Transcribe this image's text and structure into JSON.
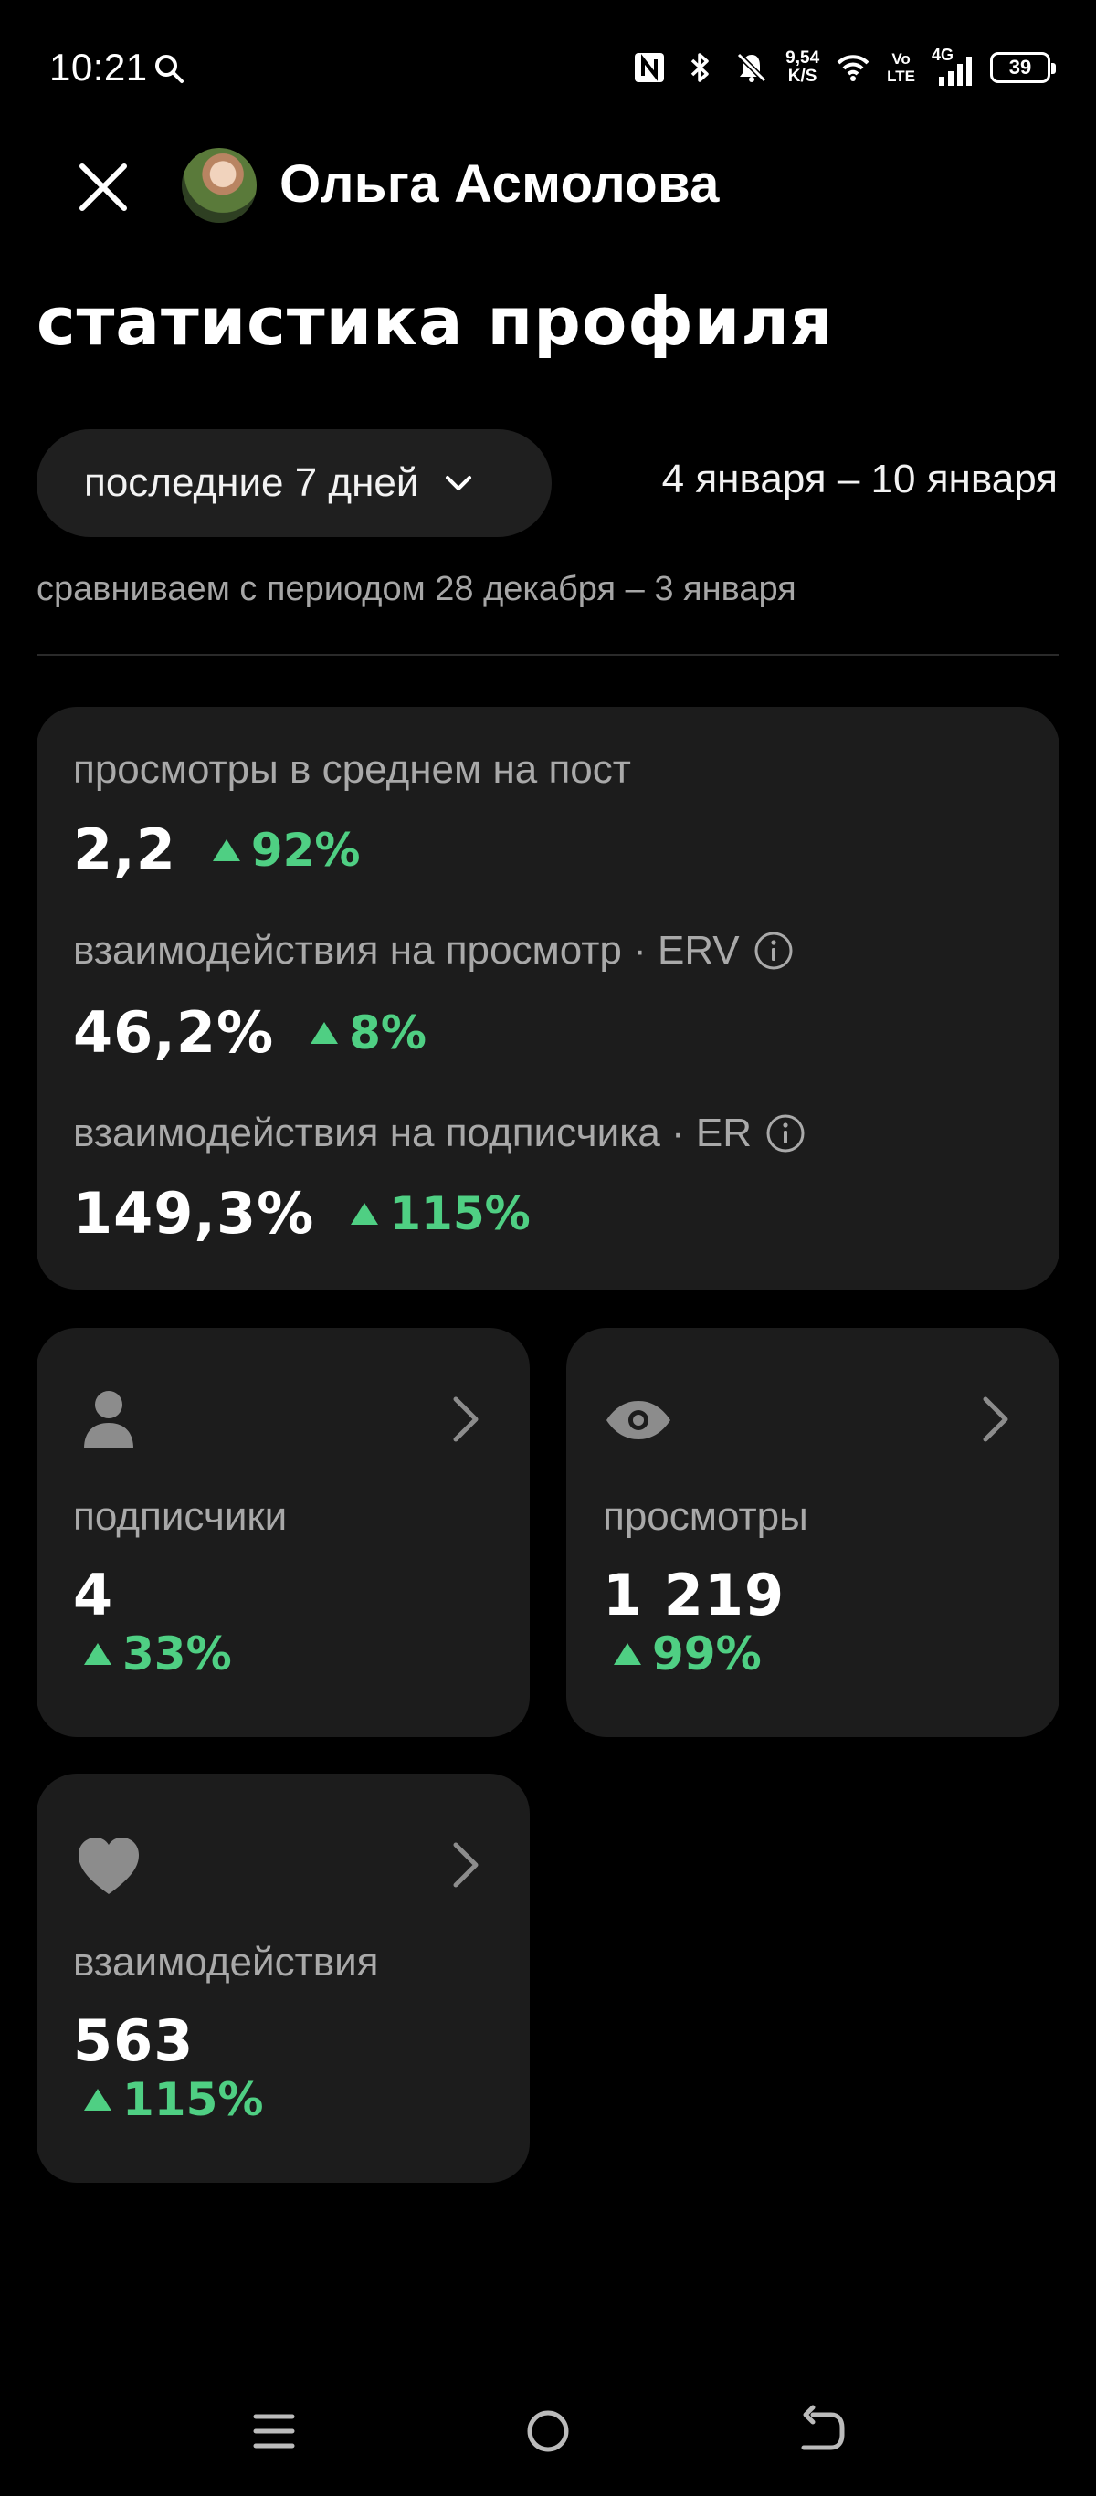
{
  "status_bar": {
    "time": "10:21",
    "net_speed_value": "9,54",
    "net_speed_unit": "K/S",
    "volte_top": "Vo",
    "volte_bottom": "LTE",
    "signal_label": "4G",
    "battery": "39"
  },
  "header": {
    "user_name": "Ольга Асмолова"
  },
  "page_title": "статистика профиля",
  "period": {
    "selected": "последние 7 дней",
    "date_range": "4 января – 10 января",
    "comparison": "сравниваем с периодом 28 декабря – 3 января"
  },
  "summary": {
    "metrics": [
      {
        "label": "просмотры в среднем на пост",
        "value": "2,2",
        "delta": "92%"
      },
      {
        "label": "взаимодействия на просмотр · ERV",
        "value": "46,2%",
        "delta": "8%"
      },
      {
        "label": "взаимодействия на подписчика · ER",
        "value": "149,3%",
        "delta": "115%"
      }
    ]
  },
  "tiles": [
    {
      "icon": "person-icon",
      "label": "подписчики",
      "value": "4",
      "delta": "33%"
    },
    {
      "icon": "eye-icon",
      "label": "просмотры",
      "value": "1 219",
      "delta": "99%"
    },
    {
      "icon": "heart-icon",
      "label": "взаимодействия",
      "value": "563",
      "delta": "115%"
    }
  ],
  "colors": {
    "background": "#000000",
    "card": "#1c1c1c",
    "positive": "#4fcf83",
    "muted_text": "#a9a9a9"
  }
}
